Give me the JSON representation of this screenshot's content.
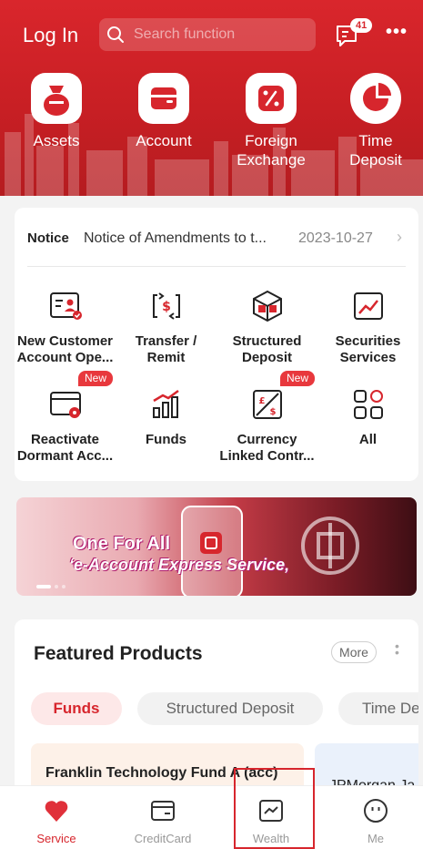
{
  "header": {
    "login_label": "Log In",
    "search_placeholder": "Search function",
    "message_count": "41",
    "more_label": "•••"
  },
  "quick_actions": [
    {
      "label": "Assets",
      "icon": "money-bag-icon"
    },
    {
      "label": "Account",
      "icon": "wallet-icon"
    },
    {
      "label": "Foreign\nExchange",
      "icon": "percent-icon"
    },
    {
      "label": "Time\nDeposit",
      "icon": "pie-chart-icon"
    }
  ],
  "notice": {
    "tag": "Notice",
    "text": "Notice of Amendments to t...",
    "date": "2023-10-27",
    "arrow": "›"
  },
  "functions": [
    {
      "label": "New Customer\nAccount Ope...",
      "icon": "id-card-icon"
    },
    {
      "label": "Transfer /\nRemit",
      "icon": "transfer-icon"
    },
    {
      "label": "Structured\nDeposit",
      "icon": "cube-icon"
    },
    {
      "label": "Securities\nServices",
      "icon": "stock-chart-icon"
    },
    {
      "label": "Reactivate\nDormant Acc...",
      "icon": "card-icon",
      "badge": "New"
    },
    {
      "label": "Funds",
      "icon": "fund-bar-icon"
    },
    {
      "label": "Currency\nLinked Contr...",
      "icon": "currency-exchange-icon",
      "badge": "New"
    },
    {
      "label": "All",
      "icon": "apps-grid-icon"
    }
  ],
  "banner": {
    "line1": "One For All",
    "line2": "‘e-Account Express Service‚"
  },
  "featured": {
    "title": "Featured Products",
    "more_label": "More",
    "tabs": [
      "Funds",
      "Structured Deposit",
      "Time De"
    ],
    "products": [
      "Franklin Technology Fund A (acc)",
      "JPMorgan Ja"
    ]
  },
  "bottom_nav": [
    {
      "label": "Service",
      "icon": "heart-icon",
      "active": true
    },
    {
      "label": "CreditCard",
      "icon": "credit-card-icon",
      "active": false
    },
    {
      "label": "Wealth",
      "icon": "wealth-chart-icon",
      "active": false
    },
    {
      "label": "Me",
      "icon": "smiley-icon",
      "active": false
    }
  ],
  "colors": {
    "brand_red": "#d7262d",
    "header_red": "#c81f24",
    "badge_red": "#e8383d"
  }
}
